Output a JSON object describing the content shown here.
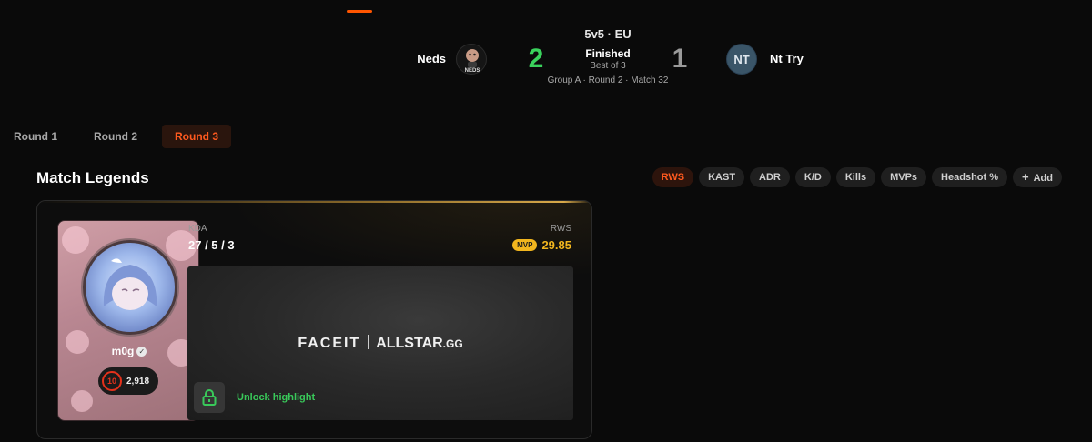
{
  "match": {
    "format": "5v5 · EU",
    "team_left": {
      "name": "Neds",
      "logo_text": "NEDS",
      "score": "2"
    },
    "team_right": {
      "name": "Nt Try",
      "logo_text": "NT",
      "score": "1"
    },
    "status": "Finished",
    "best_of": "Best of 3",
    "group_info": "Group A · Round 2 · Match 32",
    "colors": {
      "win": "#3ad25c",
      "loss": "#9a9a9a",
      "accent": "#ff5500"
    }
  },
  "rounds": {
    "tabs": [
      "Round 1",
      "Round 2",
      "Round 3"
    ],
    "active": "Round 3"
  },
  "legends": {
    "title": "Match Legends",
    "filters": [
      "RWS",
      "KAST",
      "ADR",
      "K/D",
      "Kills",
      "MVPs",
      "Headshot %"
    ],
    "active_filter": "RWS",
    "add_label": "Add",
    "add_icon": "plus-icon"
  },
  "player": {
    "name": "m0g",
    "verified_icon": "verified-check-icon",
    "level": "10",
    "elo": "2,918",
    "kda_label": "KDA",
    "kda": "27 / 5 / 3",
    "stat_label": "RWS",
    "mvp_badge": "MVP",
    "stat_value": "29.85"
  },
  "highlight": {
    "brand_left": "FACEIT",
    "brand_right_main": "ALLSTAR",
    "brand_right_suffix": ".GG",
    "lock_icon": "lock-icon",
    "unlock_label": "Unlock highlight"
  }
}
